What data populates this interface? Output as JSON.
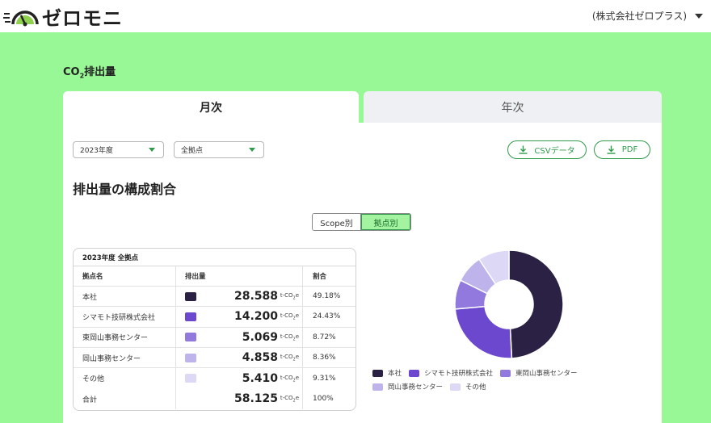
{
  "header": {
    "logo_text": "ゼロモニ",
    "company": "(株式会社ゼロプラス)"
  },
  "page": {
    "title_prefix": "CO",
    "title_sub": "2",
    "title_suffix": "排出量"
  },
  "tabs": [
    {
      "label": "月次",
      "active": true
    },
    {
      "label": "年次",
      "active": false
    }
  ],
  "filters": {
    "year": "2023年度",
    "site": "全拠点"
  },
  "actions": {
    "csv_label": "CSVデータ",
    "pdf_label": "PDF"
  },
  "section_title": "排出量の構成割合",
  "toggle": {
    "scope_label": "Scope別",
    "site_label": "拠点別",
    "selected": "拠点別"
  },
  "table": {
    "caption": "2023年度 全拠点",
    "headers": [
      "拠点名",
      "排出量",
      "割合"
    ],
    "unit_prefix": "t-CO",
    "unit_sub": "2",
    "unit_suffix": "e",
    "rows": [
      {
        "name": "本社",
        "value": "28.588",
        "share": "49.18%",
        "color": "#2b2145"
      },
      {
        "name": "シマモト技研株式会社",
        "value": "14.200",
        "share": "24.43%",
        "color": "#6c48cf"
      },
      {
        "name": "東岡山事務センター",
        "value": "5.069",
        "share": "8.72%",
        "color": "#9179dd"
      },
      {
        "name": "岡山事務センター",
        "value": "4.858",
        "share": "8.36%",
        "color": "#bfb3ec"
      },
      {
        "name": "その他",
        "value": "5.410",
        "share": "9.31%",
        "color": "#ddd8f6"
      }
    ],
    "total": {
      "name": "合計",
      "value": "58.125",
      "share": "100%"
    }
  },
  "chart_data": {
    "type": "pie",
    "donut": true,
    "labels": [
      "本社",
      "シマモト技研株式会社",
      "東岡山事務センター",
      "岡山事務センター",
      "その他"
    ],
    "values": [
      28.588,
      14.2,
      5.069,
      4.858,
      5.41
    ],
    "percentages": [
      49.18,
      24.43,
      8.72,
      8.36,
      9.31
    ],
    "colors": [
      "#2b2145",
      "#6c48cf",
      "#9179dd",
      "#bfb3ec",
      "#ddd8f6"
    ],
    "legend_position": "bottom"
  }
}
